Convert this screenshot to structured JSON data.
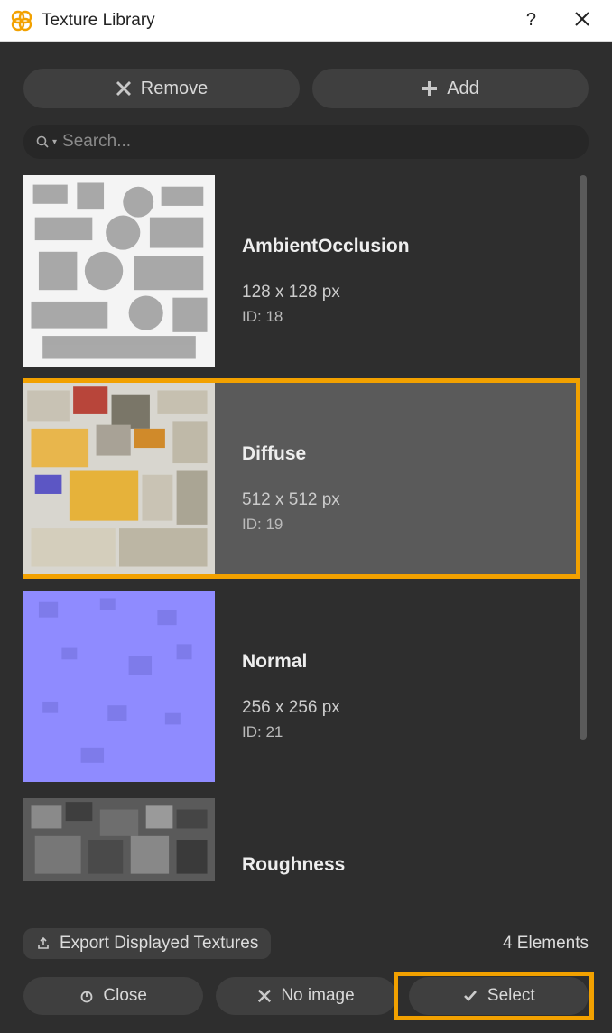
{
  "window": {
    "title": "Texture Library"
  },
  "toolbar": {
    "remove_label": "Remove",
    "add_label": "Add"
  },
  "search": {
    "placeholder": "Search...",
    "value": ""
  },
  "textures": [
    {
      "name": "AmbientOcclusion",
      "dims": "128 x 128 px",
      "id_label": "ID: 18",
      "selected": false
    },
    {
      "name": "Diffuse",
      "dims": "512 x 512 px",
      "id_label": "ID: 19",
      "selected": true
    },
    {
      "name": "Normal",
      "dims": "256 x 256 px",
      "id_label": "ID: 21",
      "selected": false
    },
    {
      "name": "Roughness",
      "dims": "",
      "id_label": "",
      "selected": false
    }
  ],
  "footer": {
    "export_label": "Export Displayed Textures",
    "elements_label": "4 Elements",
    "close_label": "Close",
    "noimage_label": "No image",
    "select_label": "Select"
  }
}
